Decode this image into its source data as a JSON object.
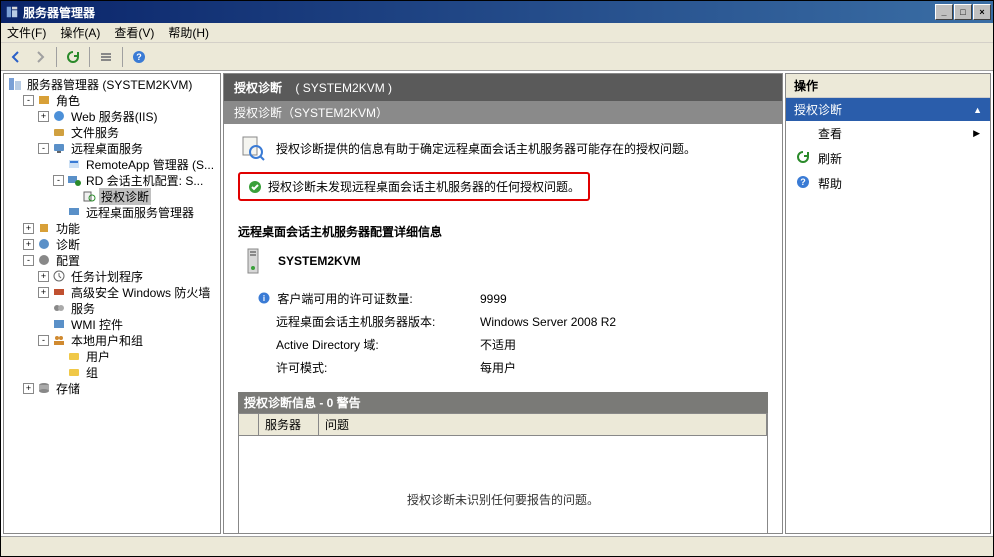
{
  "window": {
    "title": "服务器管理器"
  },
  "menus": {
    "file": "文件(F)",
    "action": "操作(A)",
    "view": "查看(V)",
    "help": "帮助(H)"
  },
  "tree": {
    "root": "服务器管理器 (SYSTEM2KVM)",
    "roles": "角色",
    "web": "Web 服务器(IIS)",
    "fileService": "文件服务",
    "rds": "远程桌面服务",
    "remoteapp": "RemoteApp 管理器 (S...",
    "rdconfig": "RD 会话主机配置: S...",
    "licdiag": "授权诊断",
    "rdsMgr": "远程桌面服务管理器",
    "features": "功能",
    "diagnostics": "诊断",
    "config": "配置",
    "scheduler": "任务计划程序",
    "firewall": "高级安全 Windows 防火墙",
    "services": "服务",
    "wmi": "WMI 控件",
    "lusrmgr": "本地用户和组",
    "users": "用户",
    "groups": "组",
    "storage": "存储"
  },
  "mid": {
    "header1_title": "授权诊断",
    "header1_host": "( SYSTEM2KVM )",
    "header2": "授权诊断（SYSTEM2KVM）",
    "intro": "授权诊断提供的信息有助于确定远程桌面会话主机服务器可能存在的授权问题。",
    "status": "授权诊断未发现远程桌面会话主机服务器的任何授权问题。",
    "section_title": "远程桌面会话主机服务器配置详细信息",
    "server_name": "SYSTEM2KVM",
    "rows": {
      "licenses_label": "客户端可用的许可证数量:",
      "licenses_value": "9999",
      "version_label": "远程桌面会话主机服务器版本:",
      "version_value": "Windows Server 2008 R2",
      "ad_label": "Active Directory 域:",
      "ad_value": "不适用",
      "licmode_label": "许可模式:",
      "licmode_value": "每用户"
    },
    "grid_title": "授权诊断信息 - 0 警告",
    "grid_cols": {
      "server": "服务器",
      "problem": "问题"
    },
    "grid_empty": "授权诊断未识别任何要报告的问题。"
  },
  "actions": {
    "pane_title": "操作",
    "band": "授权诊断",
    "view": "查看",
    "refresh": "刷新",
    "help": "帮助"
  }
}
